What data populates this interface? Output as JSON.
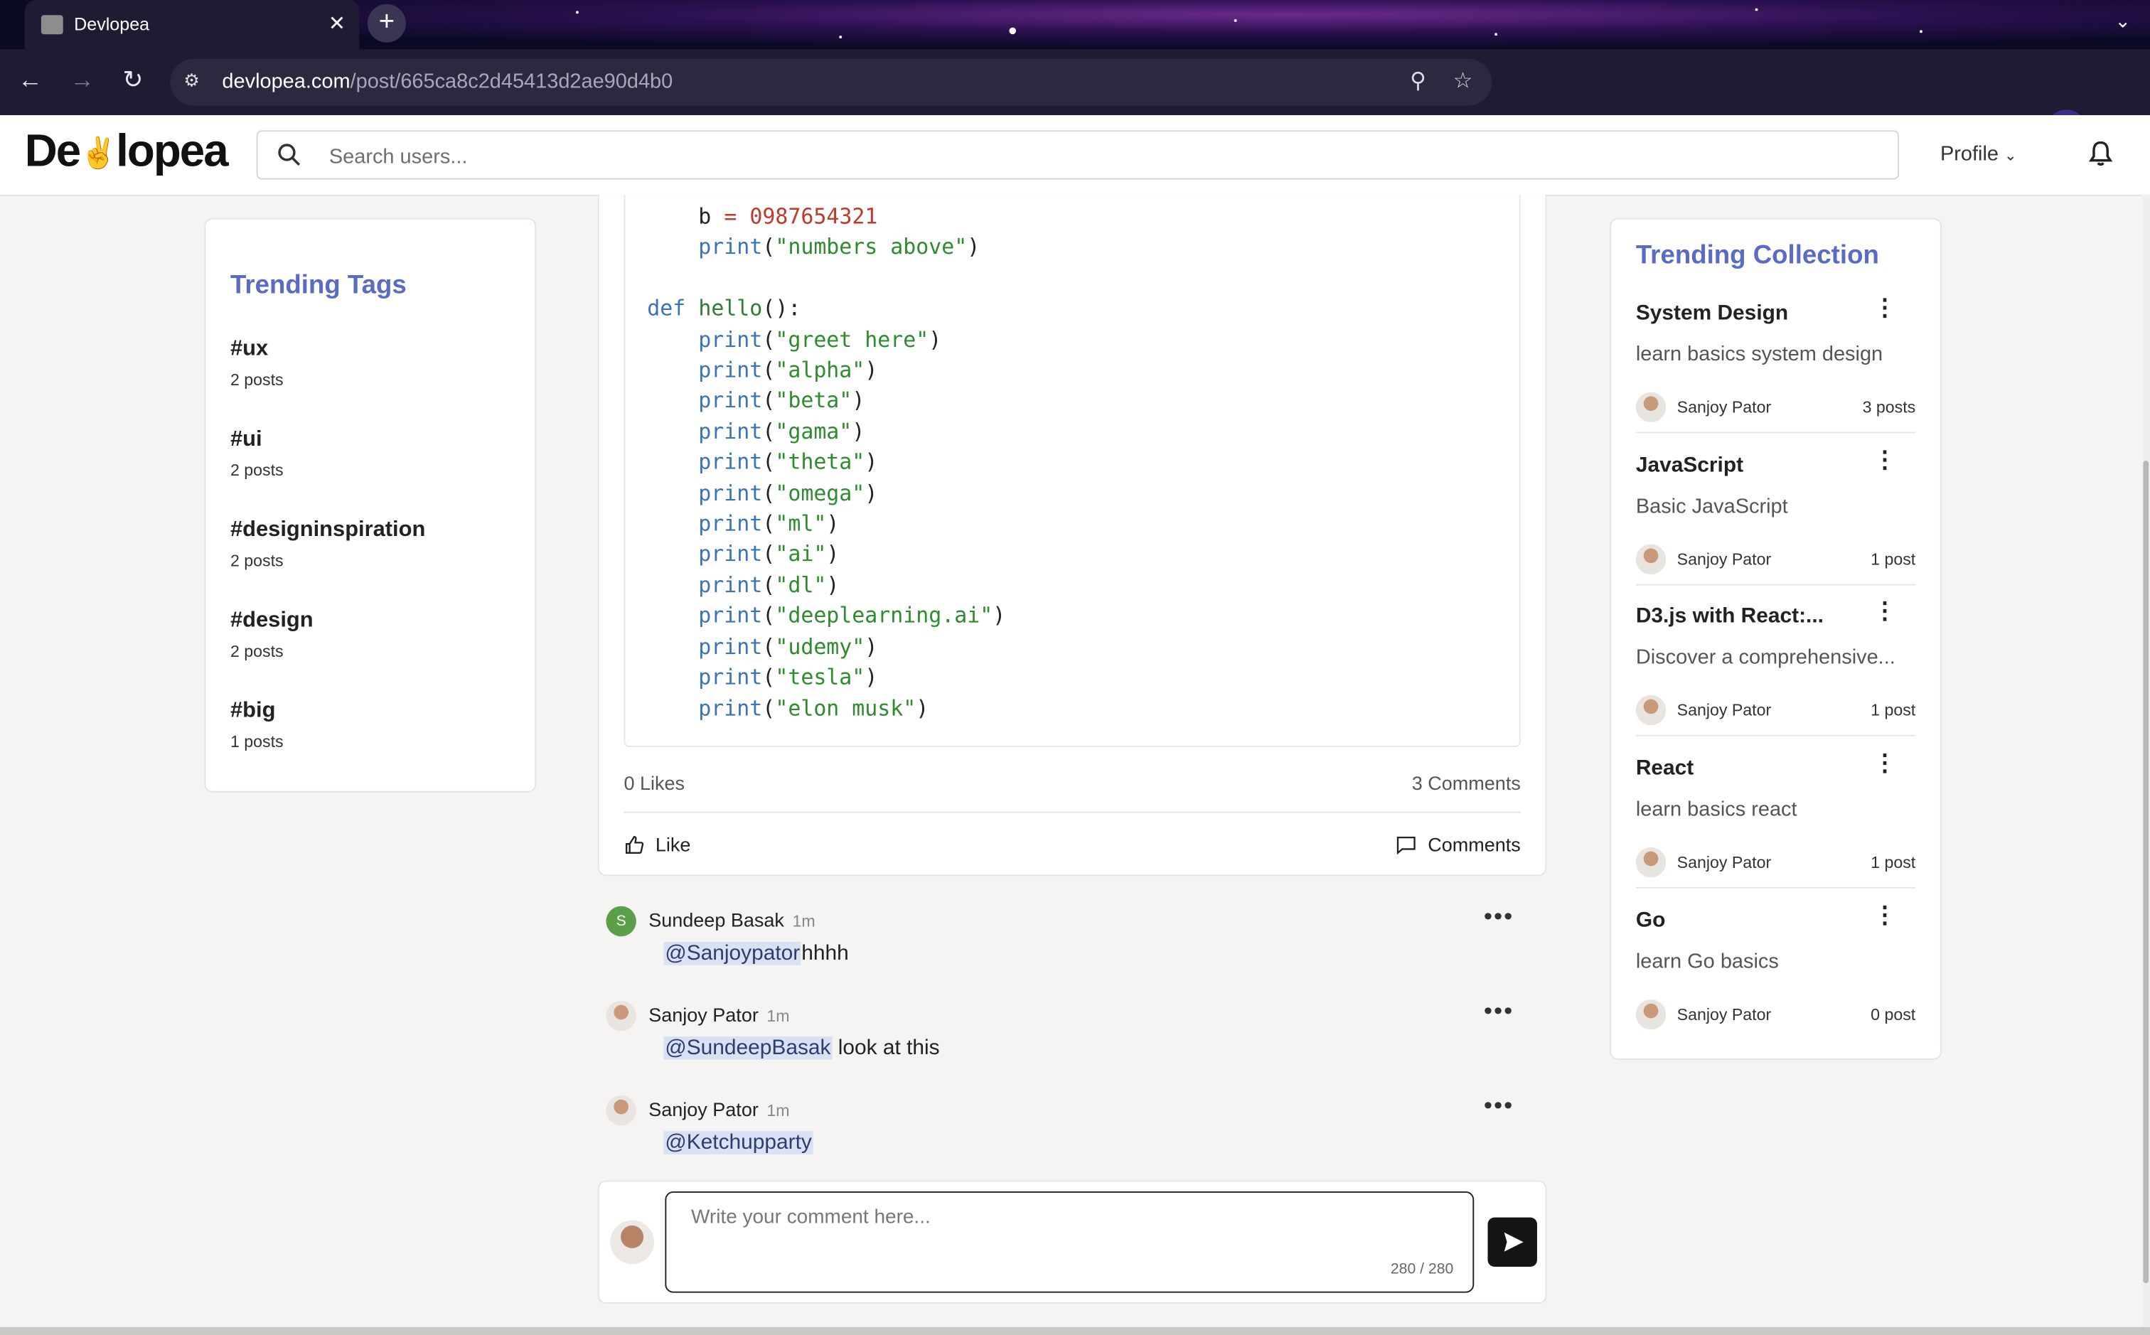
{
  "browser": {
    "tab_title": "Devlopea",
    "url_host": "devlopea.com",
    "url_path": "/post/665ca8c2d45413d2ae90d4b0"
  },
  "header": {
    "logo_left": "De",
    "logo_right": "lopea",
    "search_placeholder": "Search users...",
    "profile_label": "Profile"
  },
  "trending_tags": {
    "title": "Trending Tags",
    "items": [
      {
        "tag": "#ux",
        "count": "2 posts"
      },
      {
        "tag": "#ui",
        "count": "2 posts"
      },
      {
        "tag": "#designinspiration",
        "count": "2 posts"
      },
      {
        "tag": "#design",
        "count": "2 posts"
      },
      {
        "tag": "#big",
        "count": "1 posts"
      }
    ]
  },
  "post": {
    "code_lines": {
      "b_var": "b",
      "b_eq": "=",
      "b_val": "0987654321",
      "print": "print",
      "def": "def",
      "fname": "hello",
      "p_numbers": "\"numbers above\"",
      "p1": "\"greet here\"",
      "p2": "\"alpha\"",
      "p3": "\"beta\"",
      "p4": "\"gama\"",
      "p5": "\"theta\"",
      "p6": "\"omega\"",
      "p7": "\"ml\"",
      "p8": "\"ai\"",
      "p9": "\"dl\"",
      "p10": "\"deeplearning.ai\"",
      "p11": "\"udemy\"",
      "p12": "\"tesla\"",
      "p13": "\"elon musk\""
    },
    "likes": "0 Likes",
    "comments_count": "3 Comments",
    "like_label": "Like",
    "comments_label": "Comments"
  },
  "comments": [
    {
      "author": "Sundeep Basak",
      "time": "1m",
      "mention": "@Sanjoypator",
      "text": "hhhh",
      "avatar_letter": "S"
    },
    {
      "author": "Sanjoy Pator",
      "time": "1m",
      "mention": "@SundeepBasak",
      "text": " look at this"
    },
    {
      "author": "Sanjoy Pator",
      "time": "1m",
      "mention": "@Ketchupparty",
      "text": ""
    }
  ],
  "composer": {
    "placeholder": "Write your comment here...",
    "counter": "280 / 280"
  },
  "trending_collection": {
    "title": "Trending Collection",
    "items": [
      {
        "title": "System Design",
        "desc": "learn basics system design",
        "author": "Sanjoy Pator",
        "count": "3 posts"
      },
      {
        "title": "JavaScript",
        "desc": "Basic JavaScript",
        "author": "Sanjoy Pator",
        "count": "1 post"
      },
      {
        "title": "D3.js with React:...",
        "desc": "Discover a comprehensive...",
        "author": "Sanjoy Pator",
        "count": "1 post"
      },
      {
        "title": "React",
        "desc": "learn basics react",
        "author": "Sanjoy Pator",
        "count": "1 post"
      },
      {
        "title": "Go",
        "desc": "learn Go basics",
        "author": "Sanjoy Pator",
        "count": "0 post"
      }
    ]
  },
  "colors": {
    "accent": "#5a6bc4",
    "mention_bg": "#d8e2f4",
    "send_button": "#151515"
  }
}
